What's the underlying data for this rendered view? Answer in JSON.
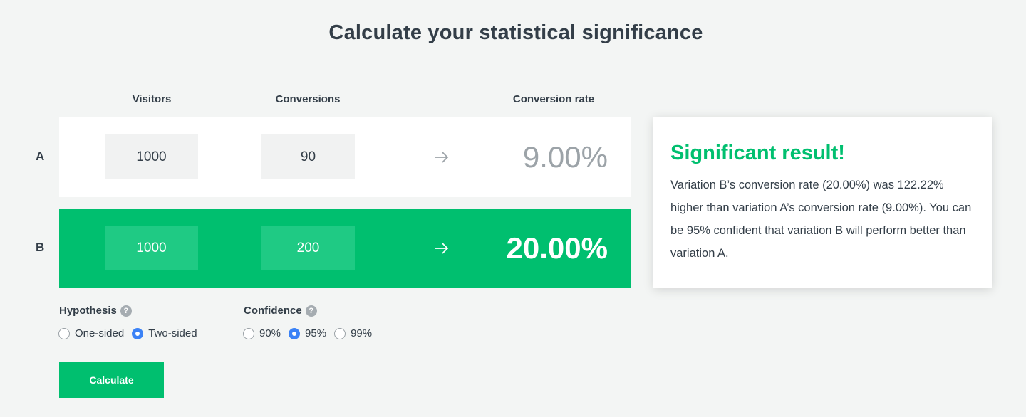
{
  "title": "Calculate your statistical significance",
  "columns": {
    "visitors": "Visitors",
    "conversions": "Conversions",
    "rate": "Conversion rate"
  },
  "rows": [
    {
      "label": "A",
      "visitors": "1000",
      "conversions": "90",
      "rate": "9.00%"
    },
    {
      "label": "B",
      "visitors": "1000",
      "conversions": "200",
      "rate": "20.00%"
    }
  ],
  "result": {
    "title": "Significant result!",
    "body": "Variation B’s conversion rate (20.00%) was 122.22% higher than variation A’s conversion rate (9.00%). You can be 95% confident that variation B will perform better than variation A."
  },
  "hypothesis": {
    "label": "Hypothesis",
    "options": [
      "One-sided",
      "Two-sided"
    ],
    "selected": "Two-sided"
  },
  "confidence": {
    "label": "Confidence",
    "options": [
      "90%",
      "95%",
      "99%"
    ],
    "selected": "95%"
  },
  "help_icon": "?",
  "calculate_label": "Calculate",
  "colors": {
    "accent": "#00bf6f",
    "radio_selected": "#3b82f6"
  }
}
